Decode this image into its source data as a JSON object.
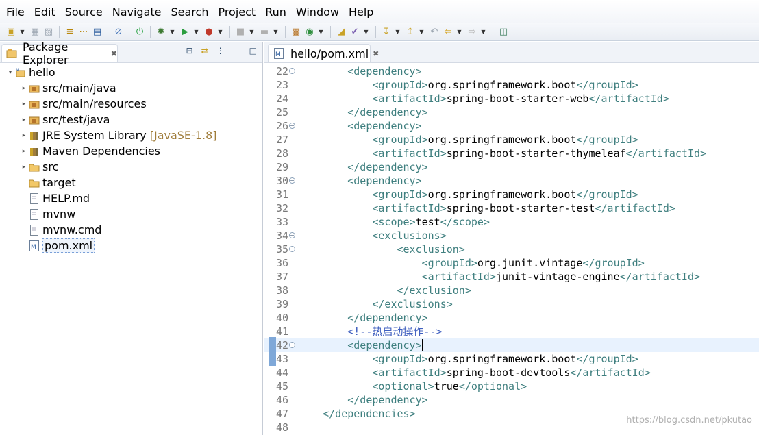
{
  "menu": [
    "File",
    "Edit",
    "Source",
    "Navigate",
    "Search",
    "Project",
    "Run",
    "Window",
    "Help"
  ],
  "explorer": {
    "tab_label": "Package Explorer",
    "items": [
      {
        "label": "hello",
        "deco": "",
        "icon": "project-icon",
        "indent": 0,
        "twisty": "▾"
      },
      {
        "label": "src/main/java",
        "deco": "",
        "icon": "source-folder-icon",
        "indent": 1,
        "twisty": "▸"
      },
      {
        "label": "src/main/resources",
        "deco": "",
        "icon": "source-folder-icon",
        "indent": 1,
        "twisty": "▸"
      },
      {
        "label": "src/test/java",
        "deco": "",
        "icon": "source-folder-icon",
        "indent": 1,
        "twisty": "▸"
      },
      {
        "label": "JRE System Library",
        "deco": "[JavaSE-1.8]",
        "icon": "library-icon",
        "indent": 1,
        "twisty": "▸"
      },
      {
        "label": "Maven Dependencies",
        "deco": "",
        "icon": "library-icon",
        "indent": 1,
        "twisty": "▸"
      },
      {
        "label": "src",
        "deco": "",
        "icon": "folder-icon",
        "indent": 1,
        "twisty": "▸"
      },
      {
        "label": "target",
        "deco": "",
        "icon": "folder-icon",
        "indent": 1,
        "twisty": ""
      },
      {
        "label": "HELP.md",
        "deco": "",
        "icon": "file-icon",
        "indent": 1,
        "twisty": ""
      },
      {
        "label": "mvnw",
        "deco": "",
        "icon": "file-icon",
        "indent": 1,
        "twisty": ""
      },
      {
        "label": "mvnw.cmd",
        "deco": "",
        "icon": "file-icon",
        "indent": 1,
        "twisty": ""
      },
      {
        "label": "pom.xml",
        "deco": "",
        "icon": "maven-file-icon",
        "indent": 1,
        "twisty": ""
      }
    ]
  },
  "editor": {
    "tab_label": "hello/pom.xml",
    "lines": [
      {
        "n": "22",
        "fold": true,
        "text": "        <dependency>",
        "type": "tag"
      },
      {
        "n": "23",
        "fold": false,
        "text": "            <groupId>org.springframework.boot</groupId>",
        "type": "tag"
      },
      {
        "n": "24",
        "fold": false,
        "text": "            <artifactId>spring-boot-starter-web</artifactId>",
        "type": "tag"
      },
      {
        "n": "25",
        "fold": false,
        "text": "        </dependency>",
        "type": "tag"
      },
      {
        "n": "26",
        "fold": true,
        "text": "        <dependency>",
        "type": "tag"
      },
      {
        "n": "27",
        "fold": false,
        "text": "            <groupId>org.springframework.boot</groupId>",
        "type": "tag"
      },
      {
        "n": "28",
        "fold": false,
        "text": "            <artifactId>spring-boot-starter-thymeleaf</artifactId>",
        "type": "tag"
      },
      {
        "n": "29",
        "fold": false,
        "text": "        </dependency>",
        "type": "tag"
      },
      {
        "n": "30",
        "fold": true,
        "text": "        <dependency>",
        "type": "tag"
      },
      {
        "n": "31",
        "fold": false,
        "text": "            <groupId>org.springframework.boot</groupId>",
        "type": "tag"
      },
      {
        "n": "32",
        "fold": false,
        "text": "            <artifactId>spring-boot-starter-test</artifactId>",
        "type": "tag"
      },
      {
        "n": "33",
        "fold": false,
        "text": "            <scope>test</scope>",
        "type": "tag"
      },
      {
        "n": "34",
        "fold": true,
        "text": "            <exclusions>",
        "type": "tag"
      },
      {
        "n": "35",
        "fold": true,
        "text": "                <exclusion>",
        "type": "tag"
      },
      {
        "n": "36",
        "fold": false,
        "text": "                    <groupId>org.junit.vintage</groupId>",
        "type": "tag"
      },
      {
        "n": "37",
        "fold": false,
        "text": "                    <artifactId>junit-vintage-engine</artifactId>",
        "type": "tag"
      },
      {
        "n": "38",
        "fold": false,
        "text": "                </exclusion>",
        "type": "tag"
      },
      {
        "n": "39",
        "fold": false,
        "text": "            </exclusions>",
        "type": "tag"
      },
      {
        "n": "40",
        "fold": false,
        "text": "        </dependency>",
        "type": "tag"
      },
      {
        "n": "41",
        "fold": false,
        "text": "        <!--热启动操作-->",
        "type": "comment"
      },
      {
        "n": "42",
        "fold": true,
        "text": "        <dependency>",
        "type": "tag",
        "current": true
      },
      {
        "n": "43",
        "fold": false,
        "text": "            <groupId>org.springframework.boot</groupId>",
        "type": "tag"
      },
      {
        "n": "44",
        "fold": false,
        "text": "            <artifactId>spring-boot-devtools</artifactId>",
        "type": "tag"
      },
      {
        "n": "45",
        "fold": false,
        "text": "            <optional>true</optional>",
        "type": "tag"
      },
      {
        "n": "46",
        "fold": false,
        "text": "        </dependency>",
        "type": "tag"
      },
      {
        "n": "47",
        "fold": false,
        "text": "    </dependencies>",
        "type": "tag"
      },
      {
        "n": "48",
        "fold": false,
        "text": "",
        "type": "tag"
      }
    ]
  },
  "watermark": "https://blog.csdn.net/pkutao"
}
